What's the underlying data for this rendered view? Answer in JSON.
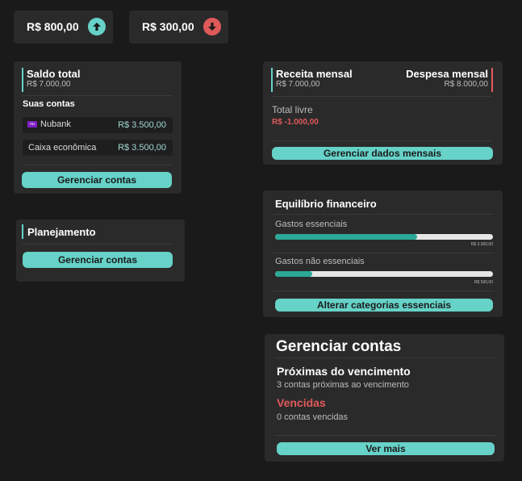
{
  "summary": {
    "income": "R$ 800,00",
    "expense": "R$ 300,00"
  },
  "saldo": {
    "title": "Saldo total",
    "value": "R$ 7.000,00",
    "accounts_title": "Suas contas",
    "accounts": [
      {
        "name": "Nubank",
        "amount": "R$ 3.500,00",
        "icon": "nubank-logo"
      },
      {
        "name": "Caixa econômica",
        "amount": "R$ 3.500,00"
      }
    ],
    "button": "Gerenciar contas"
  },
  "planejamento": {
    "title": "Planejamento",
    "button": "Gerenciar contas"
  },
  "mensal": {
    "income_label": "Receita mensal",
    "income_value": "R$ 7.000,00",
    "expense_label": "Despesa mensal",
    "expense_value": "R$ 8.000,00",
    "free_label": "Total livre",
    "free_value": "R$ -1.000,00",
    "button": "Gerenciar dados mensais"
  },
  "equilibrio": {
    "title": "Equilíbrio financeiro",
    "essential_label": "Gastos essenciais",
    "essential_limit": "R$ 3.000,00",
    "essential_progress": 0.65,
    "nonessential_label": "Gastos não essenciais",
    "nonessential_limit": "R$ 500,00",
    "nonessential_progress": 0.17,
    "button": "Alterar categorias essenciais"
  },
  "gerenciar": {
    "title": "Gerenciar contas",
    "upcoming_title": "Próximas do vencimento",
    "upcoming_text": "3 contas próximas ao vencimento",
    "overdue_title": "Vencidas",
    "overdue_text": "0 contas vencidas",
    "button": "Ver mais"
  },
  "colors": {
    "background": "#1b1a1b",
    "card": "#2b2a2b",
    "accent": "#66d2c8",
    "danger": "#e05a5a",
    "progress": "#2aa898"
  }
}
